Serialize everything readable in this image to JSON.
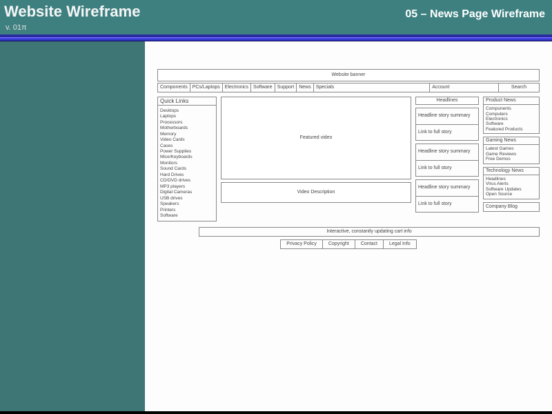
{
  "header": {
    "title": "Website Wireframe",
    "version": "v. 01π",
    "page_label": "05 – News Page Wireframe"
  },
  "wire": {
    "banner": "Website banner",
    "nav": [
      "Components",
      "PCs/Laptops",
      "Electronics",
      "Software",
      "Support",
      "News",
      "Specials",
      "Account"
    ],
    "search": "Search",
    "quick_links": {
      "title": "Quick Links",
      "items": [
        "Desktops",
        "Laptops",
        "Processors",
        "Motherboards",
        "Memory",
        "Video Cards",
        "Cases",
        "Power Supplies",
        "Mice/Keyboards",
        "Monitors",
        "Sound Cards",
        "Hard Drives",
        "CD/DVD drives",
        "MP3 players",
        "Digital Cameras",
        "USB drives",
        "Speakers",
        "Printers",
        "Software"
      ]
    },
    "featured_video": "Featured video",
    "video_desc": "Video Description",
    "headlines_label": "Headlines",
    "story_summary": "Headline story summary",
    "story_link": "Link to full story",
    "sections": {
      "product_news": {
        "title": "Product News",
        "items": [
          "Components",
          "Computers",
          "Electronics",
          "Software",
          "Featured Products"
        ]
      },
      "gaming_news": {
        "title": "Gaming News",
        "items": [
          "Latest Games",
          "Game Reviews",
          "Free Demos"
        ]
      },
      "tech_news": {
        "title": "Technology News",
        "items": [
          "Headlines",
          "Virus Alerts",
          "Software Updates",
          "Open Source"
        ]
      }
    },
    "company_blog": "Company Blog",
    "cart_bar": "Interactive, constantly updating cart info",
    "footer": [
      "Privacy Policy",
      "Copyright",
      "Contact",
      "Legal Info"
    ]
  }
}
